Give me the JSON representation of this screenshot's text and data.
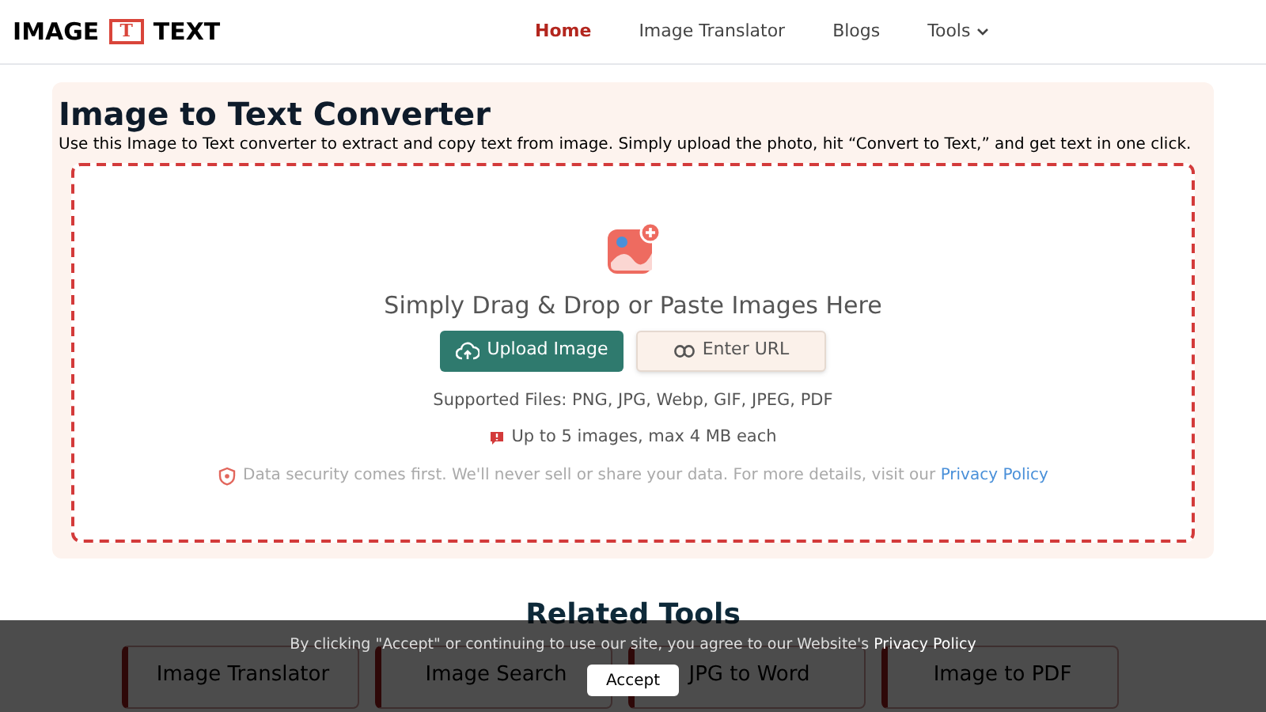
{
  "header": {
    "logo_left": "IMAGE",
    "logo_mark": "T",
    "logo_right": "TEXT",
    "nav": [
      {
        "label": "Home",
        "selected": true,
        "kind": "link"
      },
      {
        "label": "Image Translator",
        "selected": false,
        "kind": "link"
      },
      {
        "label": "Blogs",
        "selected": false,
        "kind": "link"
      },
      {
        "label": "Tools",
        "selected": false,
        "kind": "dropdown"
      }
    ]
  },
  "converter": {
    "title": "Image to Text Converter",
    "description": "Use this Image to Text converter to extract and copy text from image. Simply upload the photo, hit “Convert to Text,” and get text in one click.",
    "drop_zone": {
      "heading": "Simply Drag & Drop or Paste Images Here",
      "upload_button": "Upload Image",
      "url_button": "Enter URL",
      "supported": "Supported Files: PNG, JPG, Webp, GIF, JPEG, PDF",
      "limit": "Up to 5 images, max 4 MB each",
      "security": "Data security comes first. We'll never sell or share your data. For more details, visit our",
      "security_link": "Privacy Policy"
    }
  },
  "related": {
    "title": "Related Tools",
    "tools": [
      "Image Translator",
      "Image Search",
      "JPG to Word",
      "Image to PDF"
    ]
  },
  "cookie_banner": {
    "text": "By clicking \"Accept\" or continuing to use our site, you agree to our Website's",
    "link": "Privacy Policy",
    "button": "Accept"
  }
}
